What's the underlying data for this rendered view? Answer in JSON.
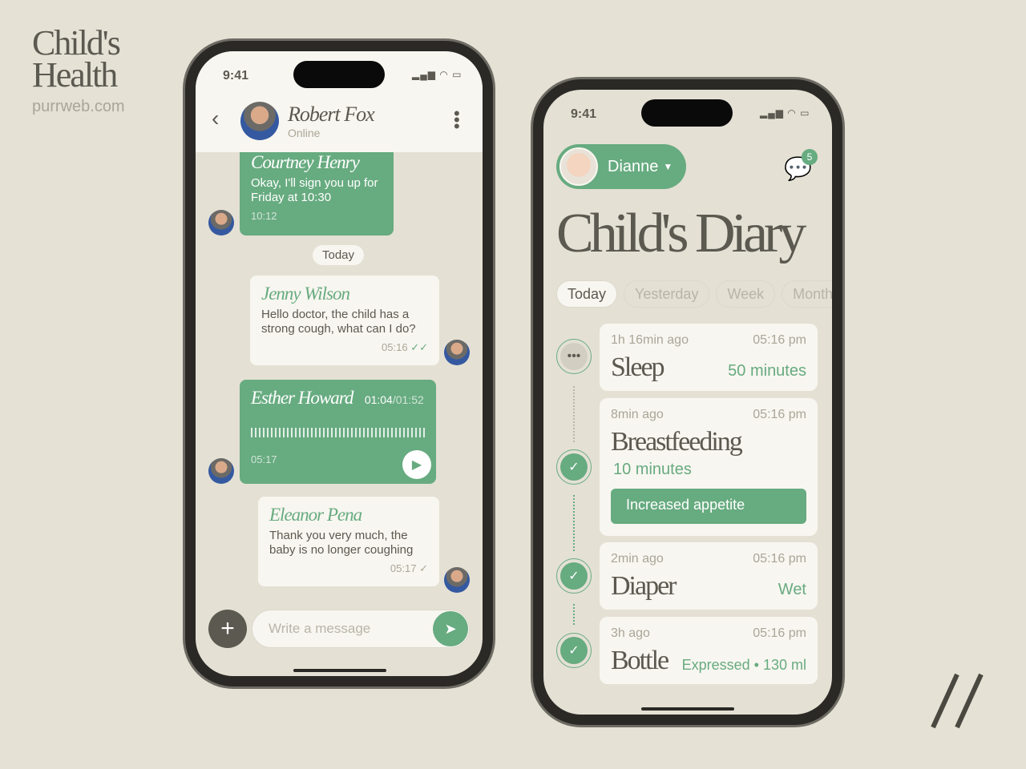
{
  "brand": {
    "title_line1": "Child's",
    "title_line2": "Health",
    "url": "purrweb.com"
  },
  "colors": {
    "accent": "#67ab80",
    "background": "#e5e1d5",
    "card": "#f8f6f0",
    "text": "#5b5950"
  },
  "chat": {
    "status_time": "9:41",
    "contact": {
      "name": "Robert Fox",
      "status": "Online"
    },
    "messages": [
      {
        "sender": "Courtney Henry",
        "text": "Okay, I'll sign you up for Friday at 10:30",
        "time": "10:12"
      },
      {
        "sender": "Jenny Wilson",
        "text": "Hello doctor, the child has a strong cough, what can I do?",
        "time": "05:16",
        "read": true
      },
      {
        "sender": "Esther Howard",
        "voice_position": "01:04",
        "voice_length": "/01:52",
        "time": "05:17"
      },
      {
        "sender": "Eleanor Pena",
        "text": "Thank you very much, the baby is no longer coughing",
        "time": "05:17",
        "read": false
      }
    ],
    "date_divider": "Today",
    "input_placeholder": "Write a message"
  },
  "diary": {
    "status_time": "9:41",
    "child_name": "Dianne",
    "notifications": "5",
    "title": "Child's Diary",
    "tabs": [
      "Today",
      "Yesterday",
      "Week",
      "Month"
    ],
    "entries": [
      {
        "ago": "1h 16min ago",
        "time": "05:16 pm",
        "title": "Sleep",
        "value": "50 minutes",
        "state": "in-progress"
      },
      {
        "ago": "8min ago",
        "time": "05:16 pm",
        "title": "Breastfeeding",
        "value": "10 minutes",
        "note": "Increased appetite",
        "state": "done"
      },
      {
        "ago": "2min ago",
        "time": "05:16 pm",
        "title": "Diaper",
        "value": "Wet",
        "state": "done"
      },
      {
        "ago": "3h ago",
        "time": "05:16 pm",
        "title": "Bottle",
        "value": "Expressed • 130 ml",
        "state": "done"
      }
    ]
  }
}
